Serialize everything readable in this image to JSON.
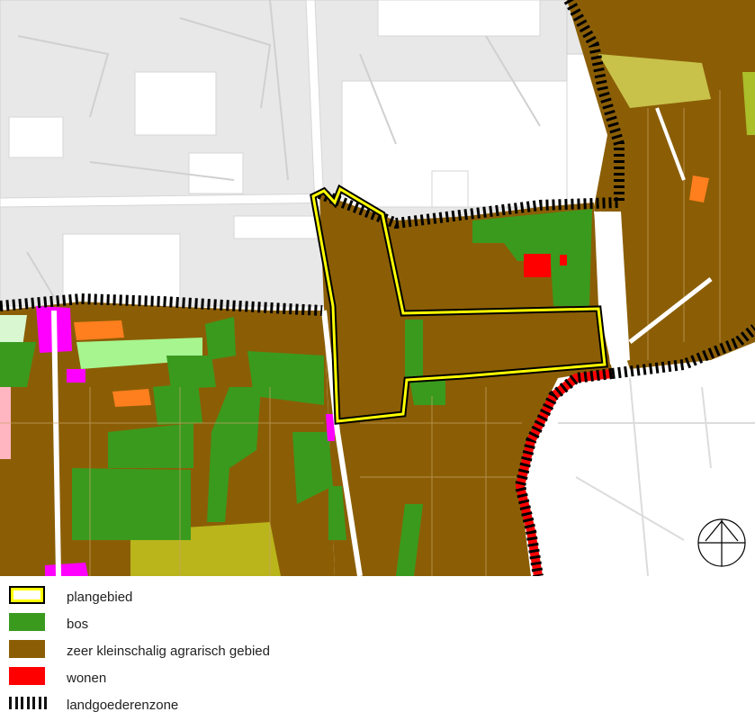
{
  "legend": {
    "items": [
      {
        "key": "plangebied",
        "label": "plangebied",
        "fill": "#ffffff",
        "stroke": "#ffff00",
        "outline": "#000000"
      },
      {
        "key": "bos",
        "label": "bos",
        "fill": "#3a9a1e"
      },
      {
        "key": "agrarisch",
        "label": "zeer kleinschalig agrarisch gebied",
        "fill": "#8b5e06"
      },
      {
        "key": "wonen",
        "label": "wonen",
        "fill": "#ff0000"
      },
      {
        "key": "landgoederenzone",
        "label": "landgoederenzone",
        "fill": "#000000"
      }
    ]
  },
  "map": {
    "colors": {
      "background": "#ffffff",
      "urban": "#e6e6e6",
      "urban_line": "#cccccc",
      "agrarisch": "#8b5e06",
      "bos": "#3a9a1e",
      "wonen": "#ff0000",
      "plangebied": "#ffff00",
      "olive": "#b9b51b",
      "light_green": "#a6f58f",
      "orange": "#ff7f1e",
      "magenta": "#ff00ff",
      "pink": "#ffb6c1",
      "hatch": "#000000",
      "hatch_red": "#ff0000"
    },
    "north_arrow_icon": "compass-north-icon"
  }
}
